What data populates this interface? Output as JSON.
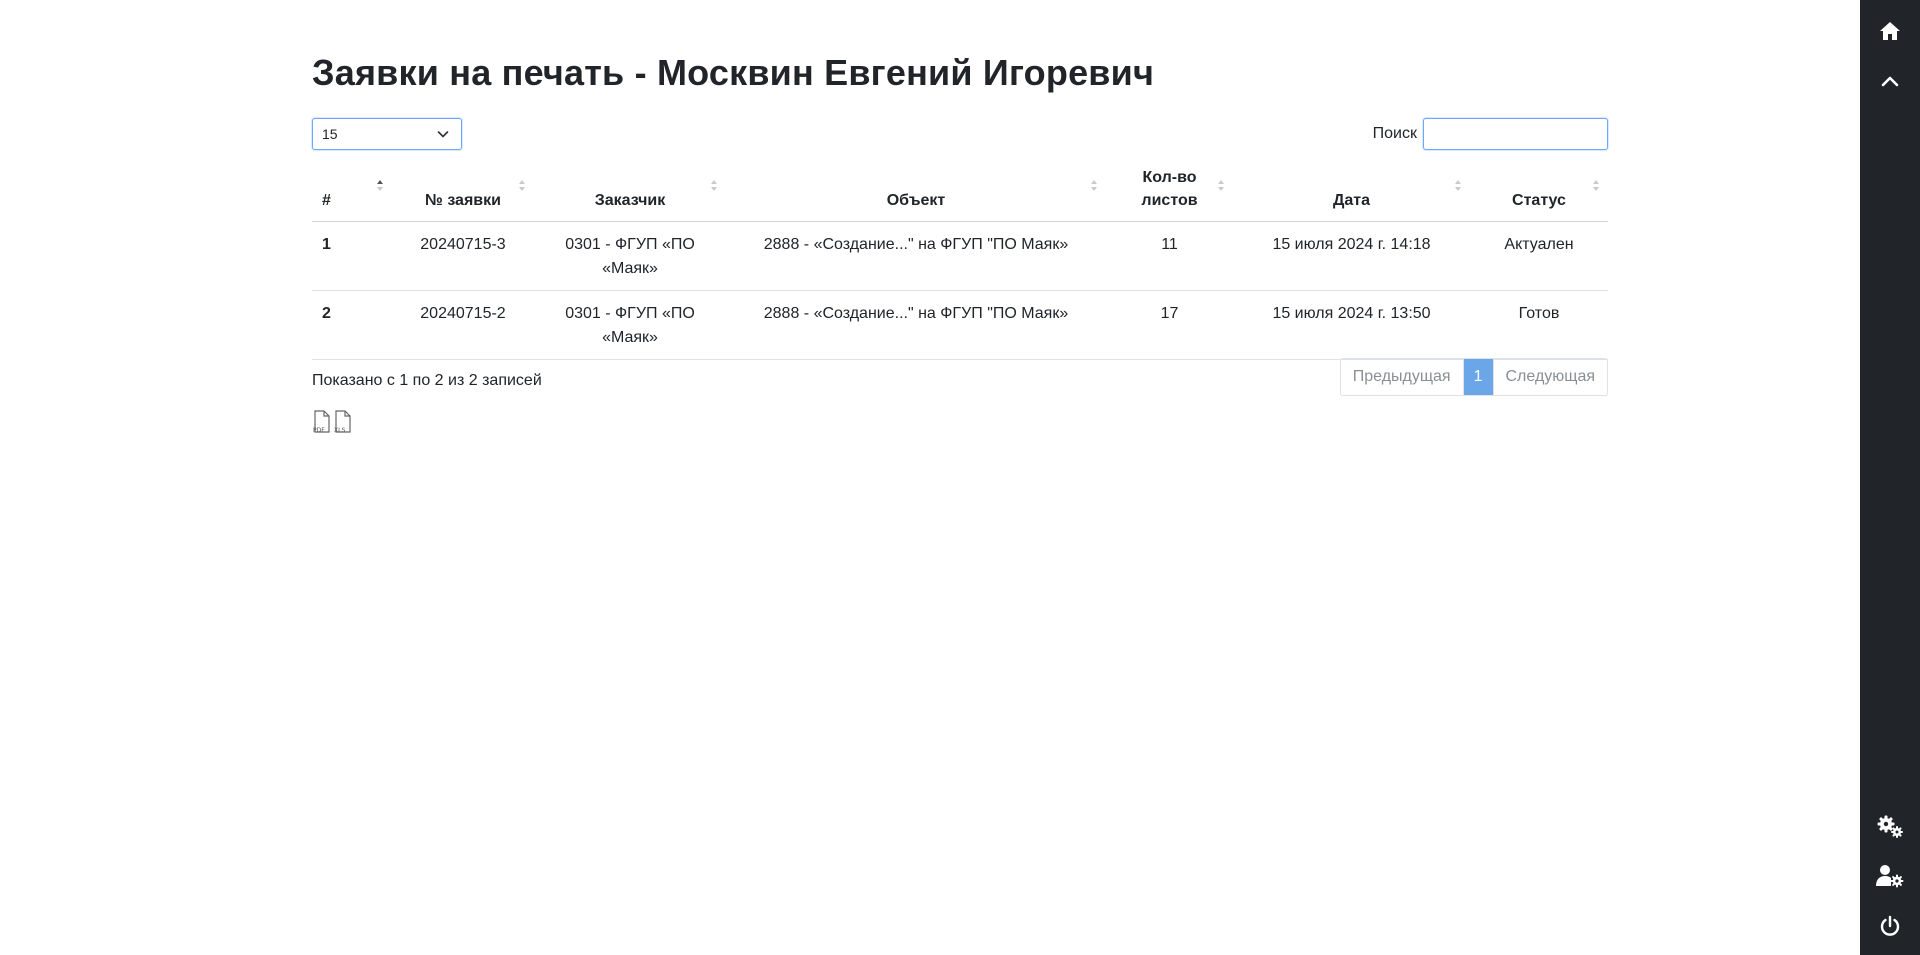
{
  "page": {
    "title": "Заявки на печать - Москвин Евгений Игоревич"
  },
  "controls": {
    "page_length": "15",
    "search_label": "Поиск",
    "search_value": ""
  },
  "table": {
    "columns": [
      "#",
      "№ заявки",
      "Заказчик",
      "Объект",
      "Кол-во листов",
      "Дата",
      "Статус"
    ],
    "rows": [
      {
        "num": "1",
        "request": "20240715-3",
        "customer": "0301 - ФГУП «ПО «Маяк»",
        "object": "2888 - «Создание...\" на ФГУП \"ПО Маяк»",
        "sheets": "11",
        "date": "15 июля 2024 г. 14:18",
        "status": "Актуален"
      },
      {
        "num": "2",
        "request": "20240715-2",
        "customer": "0301 - ФГУП «ПО «Маяк»",
        "object": "2888 - «Создание...\" на ФГУП \"ПО Маяк»",
        "sheets": "17",
        "date": "15 июля 2024 г. 13:50",
        "status": "Готов"
      }
    ]
  },
  "footer": {
    "info": "Показано с 1 по 2 из 2 записей",
    "prev": "Предыдущая",
    "page": "1",
    "next": "Следующая",
    "exports": [
      "PDF",
      "XLS"
    ]
  },
  "sidebar": {
    "top_icons": [
      "home-icon",
      "chevron-up-icon"
    ],
    "bottom_icons": [
      "gears-icon",
      "user-gear-icon",
      "power-icon"
    ]
  },
  "colors": {
    "sidebar_bg": "#212529",
    "active_page": "#6aa6e8",
    "focus_border": "#6ea8fe"
  }
}
